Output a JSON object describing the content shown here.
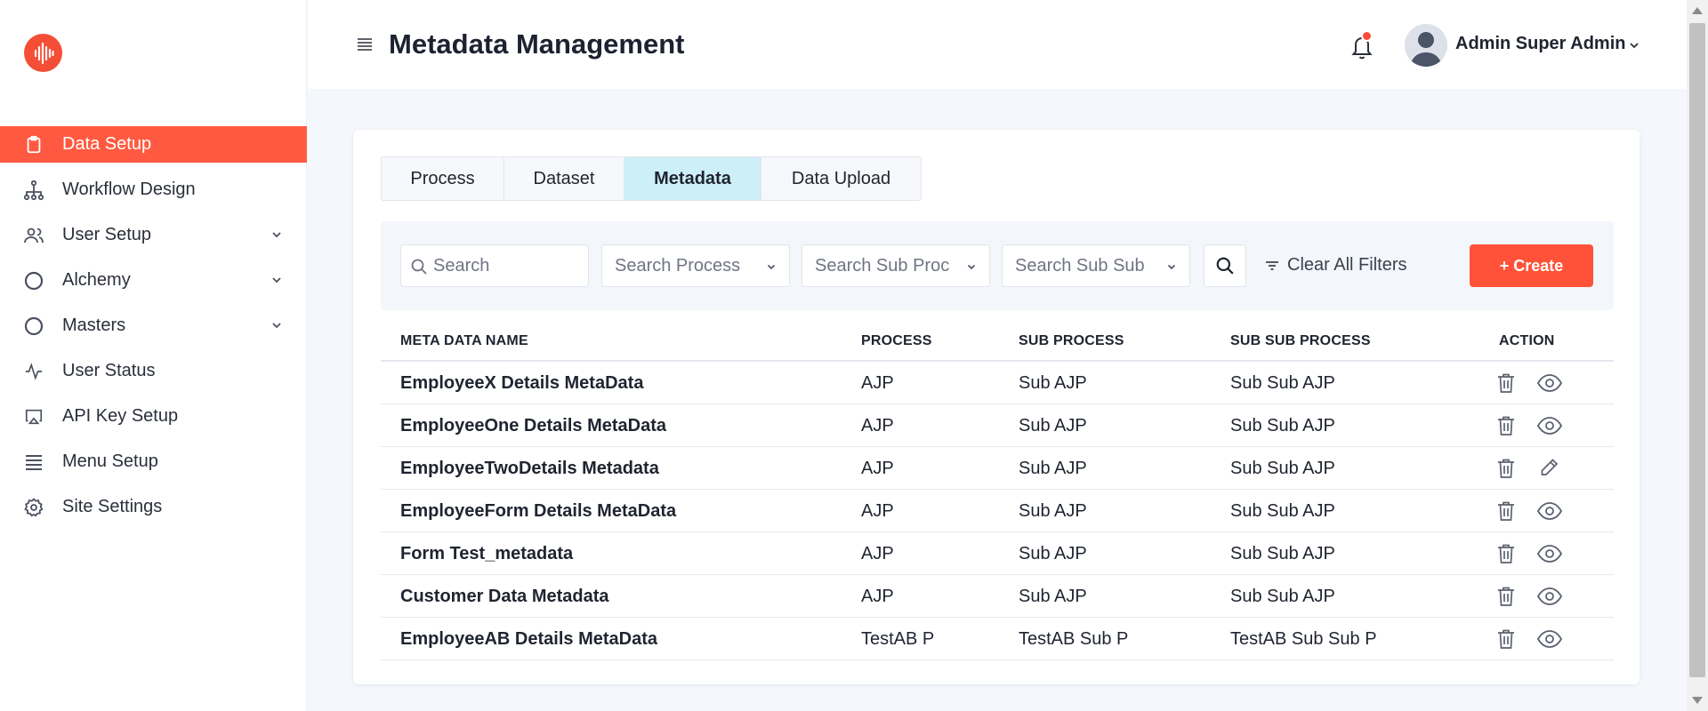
{
  "header": {
    "title": "Metadata Management",
    "user_name": "Admin Super Admin"
  },
  "sidebar": {
    "items": [
      {
        "label": "Data Setup",
        "icon": "clipboard-icon",
        "active": true
      },
      {
        "label": "Workflow Design",
        "icon": "hierarchy-icon"
      },
      {
        "label": "User Setup",
        "icon": "users-icon",
        "expandable": true
      },
      {
        "label": "Alchemy",
        "icon": "circle-icon",
        "expandable": true
      },
      {
        "label": "Masters",
        "icon": "circle-icon",
        "expandable": true
      },
      {
        "label": "User Status",
        "icon": "activity-icon"
      },
      {
        "label": "API Key Setup",
        "icon": "airplay-icon"
      },
      {
        "label": "Menu Setup",
        "icon": "list-icon"
      },
      {
        "label": "Site Settings",
        "icon": "gear-icon"
      }
    ]
  },
  "tabs": [
    {
      "label": "Process"
    },
    {
      "label": "Dataset"
    },
    {
      "label": "Metadata",
      "active": true
    },
    {
      "label": "Data Upload"
    }
  ],
  "filters": {
    "search_placeholder": "Search",
    "process_placeholder": "Search Process",
    "sub_process_placeholder": "Search Sub Proc",
    "sub_sub_process_placeholder": "Search Sub Sub",
    "clear_label": "Clear All Filters",
    "create_label": "+ Create"
  },
  "table": {
    "headers": [
      "META DATA NAME",
      "PROCESS",
      "SUB PROCESS",
      "SUB SUB PROCESS",
      "ACTION"
    ],
    "rows": [
      {
        "name": "EmployeeX Details MetaData",
        "process": "AJP",
        "sub_process": "Sub AJP",
        "sub_sub_process": "Sub Sub AJP",
        "secondary_action": "eye-icon"
      },
      {
        "name": "EmployeeOne Details MetaData",
        "process": "AJP",
        "sub_process": "Sub AJP",
        "sub_sub_process": "Sub Sub AJP",
        "secondary_action": "eye-icon"
      },
      {
        "name": "EmployeeTwoDetails Metadata",
        "process": "AJP",
        "sub_process": "Sub AJP",
        "sub_sub_process": "Sub Sub AJP",
        "secondary_action": "pencil-icon"
      },
      {
        "name": "EmployeeForm Details MetaData",
        "process": "AJP",
        "sub_process": "Sub AJP",
        "sub_sub_process": "Sub Sub AJP",
        "secondary_action": "eye-icon"
      },
      {
        "name": "Form Test_metadata",
        "process": "AJP",
        "sub_process": "Sub AJP",
        "sub_sub_process": "Sub Sub AJP",
        "secondary_action": "eye-icon"
      },
      {
        "name": "Customer Data Metadata",
        "process": "AJP",
        "sub_process": "Sub AJP",
        "sub_sub_process": "Sub Sub AJP",
        "secondary_action": "eye-icon"
      },
      {
        "name": "EmployeeAB Details MetaData",
        "process": "TestAB P",
        "sub_process": "TestAB Sub P",
        "sub_sub_process": "TestAB Sub Sub P",
        "secondary_action": "eye-icon"
      }
    ]
  },
  "colors": {
    "accent": "#ff5a41",
    "active_tab": "#cdeff8",
    "notification_dot": "#ff4d3d"
  }
}
